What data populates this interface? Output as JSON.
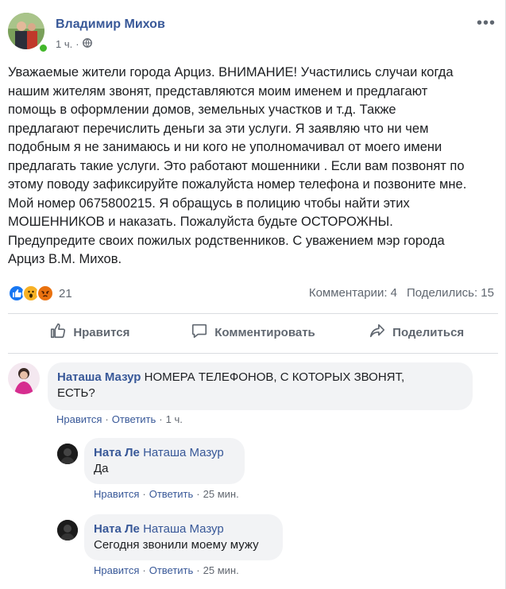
{
  "post": {
    "author": "Владимир Михов",
    "time": "1 ч.",
    "meta_sep": "·",
    "more": "•••",
    "text_lines": [
      "Уважаемые жители города Арциз. ВНИМАНИЕ! Участились случаи когда",
      "нашим жителям звонят, представляются моим именем и предлагают",
      "помощь в оформлении домов, земельных участков и т.д. Также",
      "предлагают перечислить деньги за эти услуги. Я заявляю что ни чем",
      "подобным я не занимаюсь и ни кого не уполномачивал от моего имени",
      "предлагать такие услуги. Это работают мошенники . Если вам позвонят по",
      "этому поводу зафиксируйте пожалуйста номер телефона и позвоните мне.",
      "Мой номер 0675800215. Я обращусь в полицию чтобы найти этих",
      "МОШЕННИКОВ и наказать. Пожалуйста будьте ОСТОРОЖНЫ.",
      "Предупредите своих пожилых родственников. С уважением мэр города",
      "Арциз В.М. Михов."
    ],
    "reaction_count": "21",
    "comments_stat": "Комментарии: 4",
    "shares_stat": "Поделились: 15"
  },
  "actions": {
    "like": "Нравится",
    "comment": "Комментировать",
    "share": "Поделиться"
  },
  "comments": [
    {
      "author": "Наташа Мазур",
      "mention": "",
      "line1": "НОМЕРА ТЕЛЕФОНОВ, С КОТОРЫХ ЗВОНЯТ,",
      "line2": "ЕСТЬ?",
      "like": "Нравится",
      "reply": "Ответить",
      "time": "1 ч."
    },
    {
      "author": "Ната Ле",
      "mention": "Наташа Мазур",
      "line1": "Да",
      "like": "Нравится",
      "reply": "Ответить",
      "time": "25 мин."
    },
    {
      "author": "Ната Ле",
      "mention": "Наташа Мазур",
      "line1": "Сегодня звонили моему мужу",
      "like": "Нравится",
      "reply": "Ответить",
      "time": "25 мин."
    }
  ],
  "sep": "·",
  "colors": {
    "link": "#385898",
    "like_blue": "#1877f2",
    "online": "#42b72a",
    "bubble": "#f2f3f5"
  },
  "icons": [
    "globe-icon",
    "like-reaction-icon",
    "wow-reaction-icon",
    "angry-reaction-icon",
    "thumbs-up-icon",
    "comment-icon",
    "share-icon"
  ]
}
